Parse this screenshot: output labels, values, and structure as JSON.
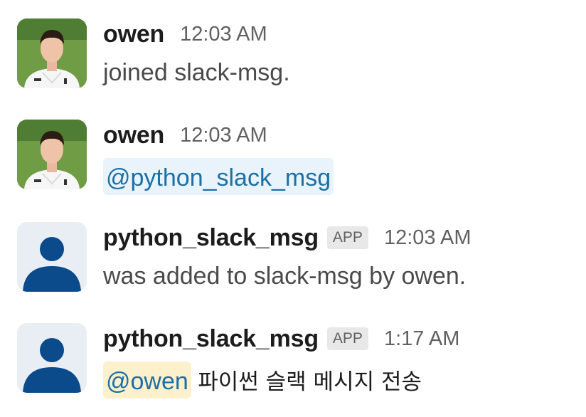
{
  "messages": [
    {
      "author": "owen",
      "time": "12:03 AM",
      "text": "joined slack-msg."
    },
    {
      "author": "owen",
      "time": "12:03 AM",
      "mention": "@python_slack_msg"
    },
    {
      "author": "python_slack_msg",
      "badge": "APP",
      "time": "12:03 AM",
      "text": "was added to slack-msg by owen."
    },
    {
      "author": "python_slack_msg",
      "badge": "APP",
      "time": "1:17 AM",
      "mention": "@owen",
      "text": "파이썬 슬랙 메시지 전송"
    }
  ],
  "colors": {
    "mention_text": "#1d6fa5",
    "mention_bg": "#e8f3fb",
    "self_mention_bg": "#fdf1cd",
    "bot_avatar": "#0b4a8b"
  }
}
